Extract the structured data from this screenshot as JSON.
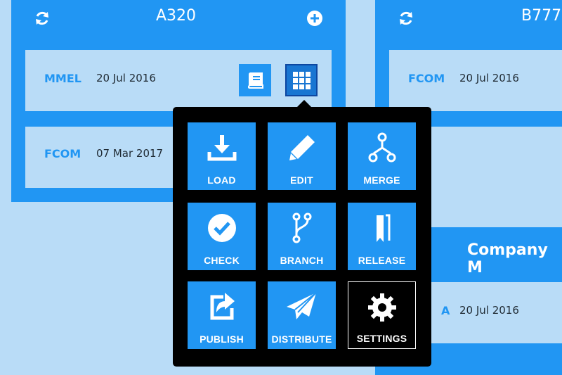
{
  "colors": {
    "background": "#b9dcf7",
    "accent": "#2196f3",
    "popover": "#000000"
  },
  "cards": [
    {
      "title": "A320",
      "rows": [
        {
          "type": "MMEL",
          "date": "20 Jul 2016"
        },
        {
          "type": "FCOM",
          "date": "07 Mar 2017"
        }
      ]
    },
    {
      "title": "B777",
      "rows": [
        {
          "type": "FCOM",
          "date": "20 Jul 2016"
        }
      ]
    },
    {
      "title": "Company M",
      "rows": [
        {
          "type": "A",
          "date": "20 Jul 2016"
        }
      ]
    }
  ],
  "menu": {
    "items": [
      {
        "label": "LOAD",
        "icon": "download-icon"
      },
      {
        "label": "EDIT",
        "icon": "pencil-icon"
      },
      {
        "label": "MERGE",
        "icon": "merge-icon"
      },
      {
        "label": "CHECK",
        "icon": "check-circle-icon"
      },
      {
        "label": "BRANCH",
        "icon": "branch-icon"
      },
      {
        "label": "RELEASE",
        "icon": "bookmark-icon"
      },
      {
        "label": "PUBLISH",
        "icon": "share-icon"
      },
      {
        "label": "DISTRIBUTE",
        "icon": "paper-plane-icon"
      },
      {
        "label": "SETTINGS",
        "icon": "gear-icon"
      }
    ],
    "selected": "SETTINGS"
  }
}
